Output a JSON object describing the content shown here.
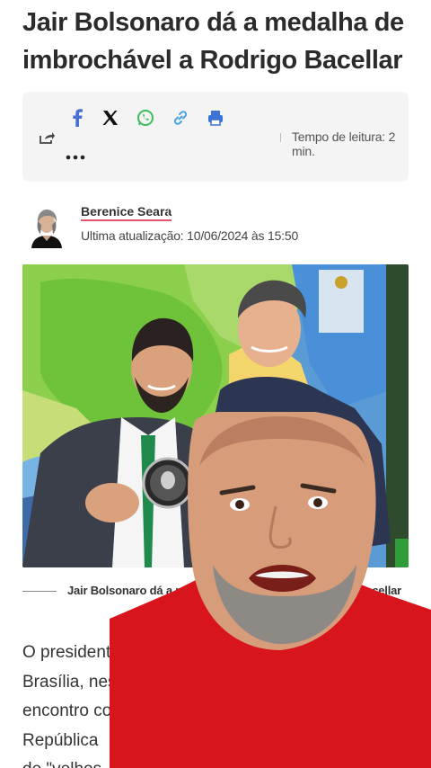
{
  "article": {
    "headline_line1": "Jair Bolsonaro dá a medalha de",
    "headline_line2": "imbrochável a Rodrigo Bacellar",
    "read_time": "Tempo de leitura: 2 min.",
    "author_name": "Berenice Seara",
    "updated": "Ultima atualização: 10/06/2024 às 15:50",
    "caption_start": "Jair Bolsonaro dá a medalha d",
    "caption_end": "Bacellar",
    "body_lines": [
      "O president",
      "Brasília, nes",
      "encontro co",
      "República",
      "de \"velhos"
    ]
  },
  "share": {
    "icons": [
      "facebook-icon",
      "x-icon",
      "whatsapp-icon",
      "link-icon",
      "print-icon",
      "share-icon",
      "more-icon"
    ],
    "colors": {
      "facebook": "#4a6fd1",
      "x": "#111111",
      "whatsapp": "#3bbf5a",
      "link": "#4aa3e0",
      "print": "#3b73d6"
    }
  },
  "overlay": {
    "shirt_color": "#d8141c",
    "wall_color": "#f2f2f2"
  }
}
